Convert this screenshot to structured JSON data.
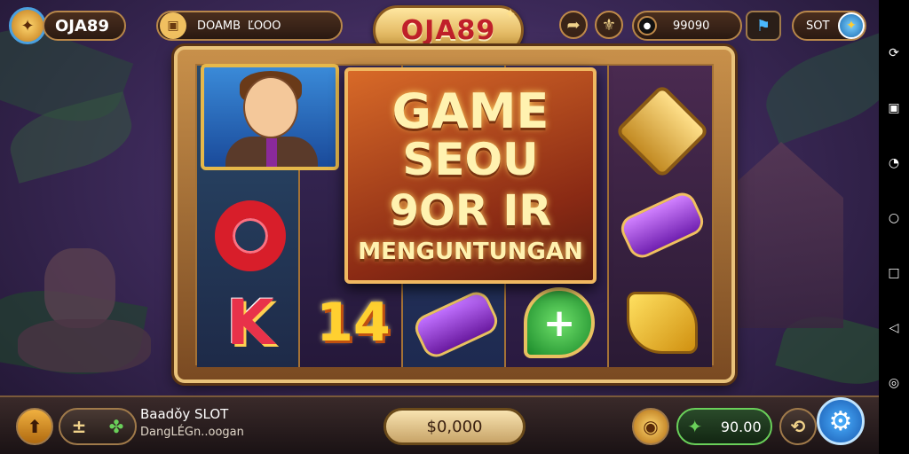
{
  "header": {
    "brand": "OJA89",
    "game_label": "DOAMB",
    "game_value": "ĽOOO",
    "logo_text": "OJA89",
    "balance_value": "99090",
    "slot_label": "SOT"
  },
  "banner": {
    "line1": "GAME",
    "line2": "SEOU",
    "line3": "9OR IR",
    "line4": "MENGUNTUNGAN"
  },
  "reels": {
    "sym_k": "K",
    "sym_14": "14",
    "sym_plus": "+"
  },
  "footer": {
    "title": "Baadǒy SLOT",
    "subtitle": "DangLÉGn..oogan",
    "up_icon": "⬆",
    "minus_label": "±",
    "bet_value": "$0,000",
    "win_value": "90.00"
  },
  "colors": {
    "accent_gold": "#e9c27a",
    "banner_red": "#8a2a14",
    "win_green": "#6ad05a",
    "spin_blue": "#1a5ab0"
  },
  "icons": [
    "coin-icon",
    "star-icon",
    "flag-icon",
    "settings-icon",
    "nav-icons"
  ]
}
